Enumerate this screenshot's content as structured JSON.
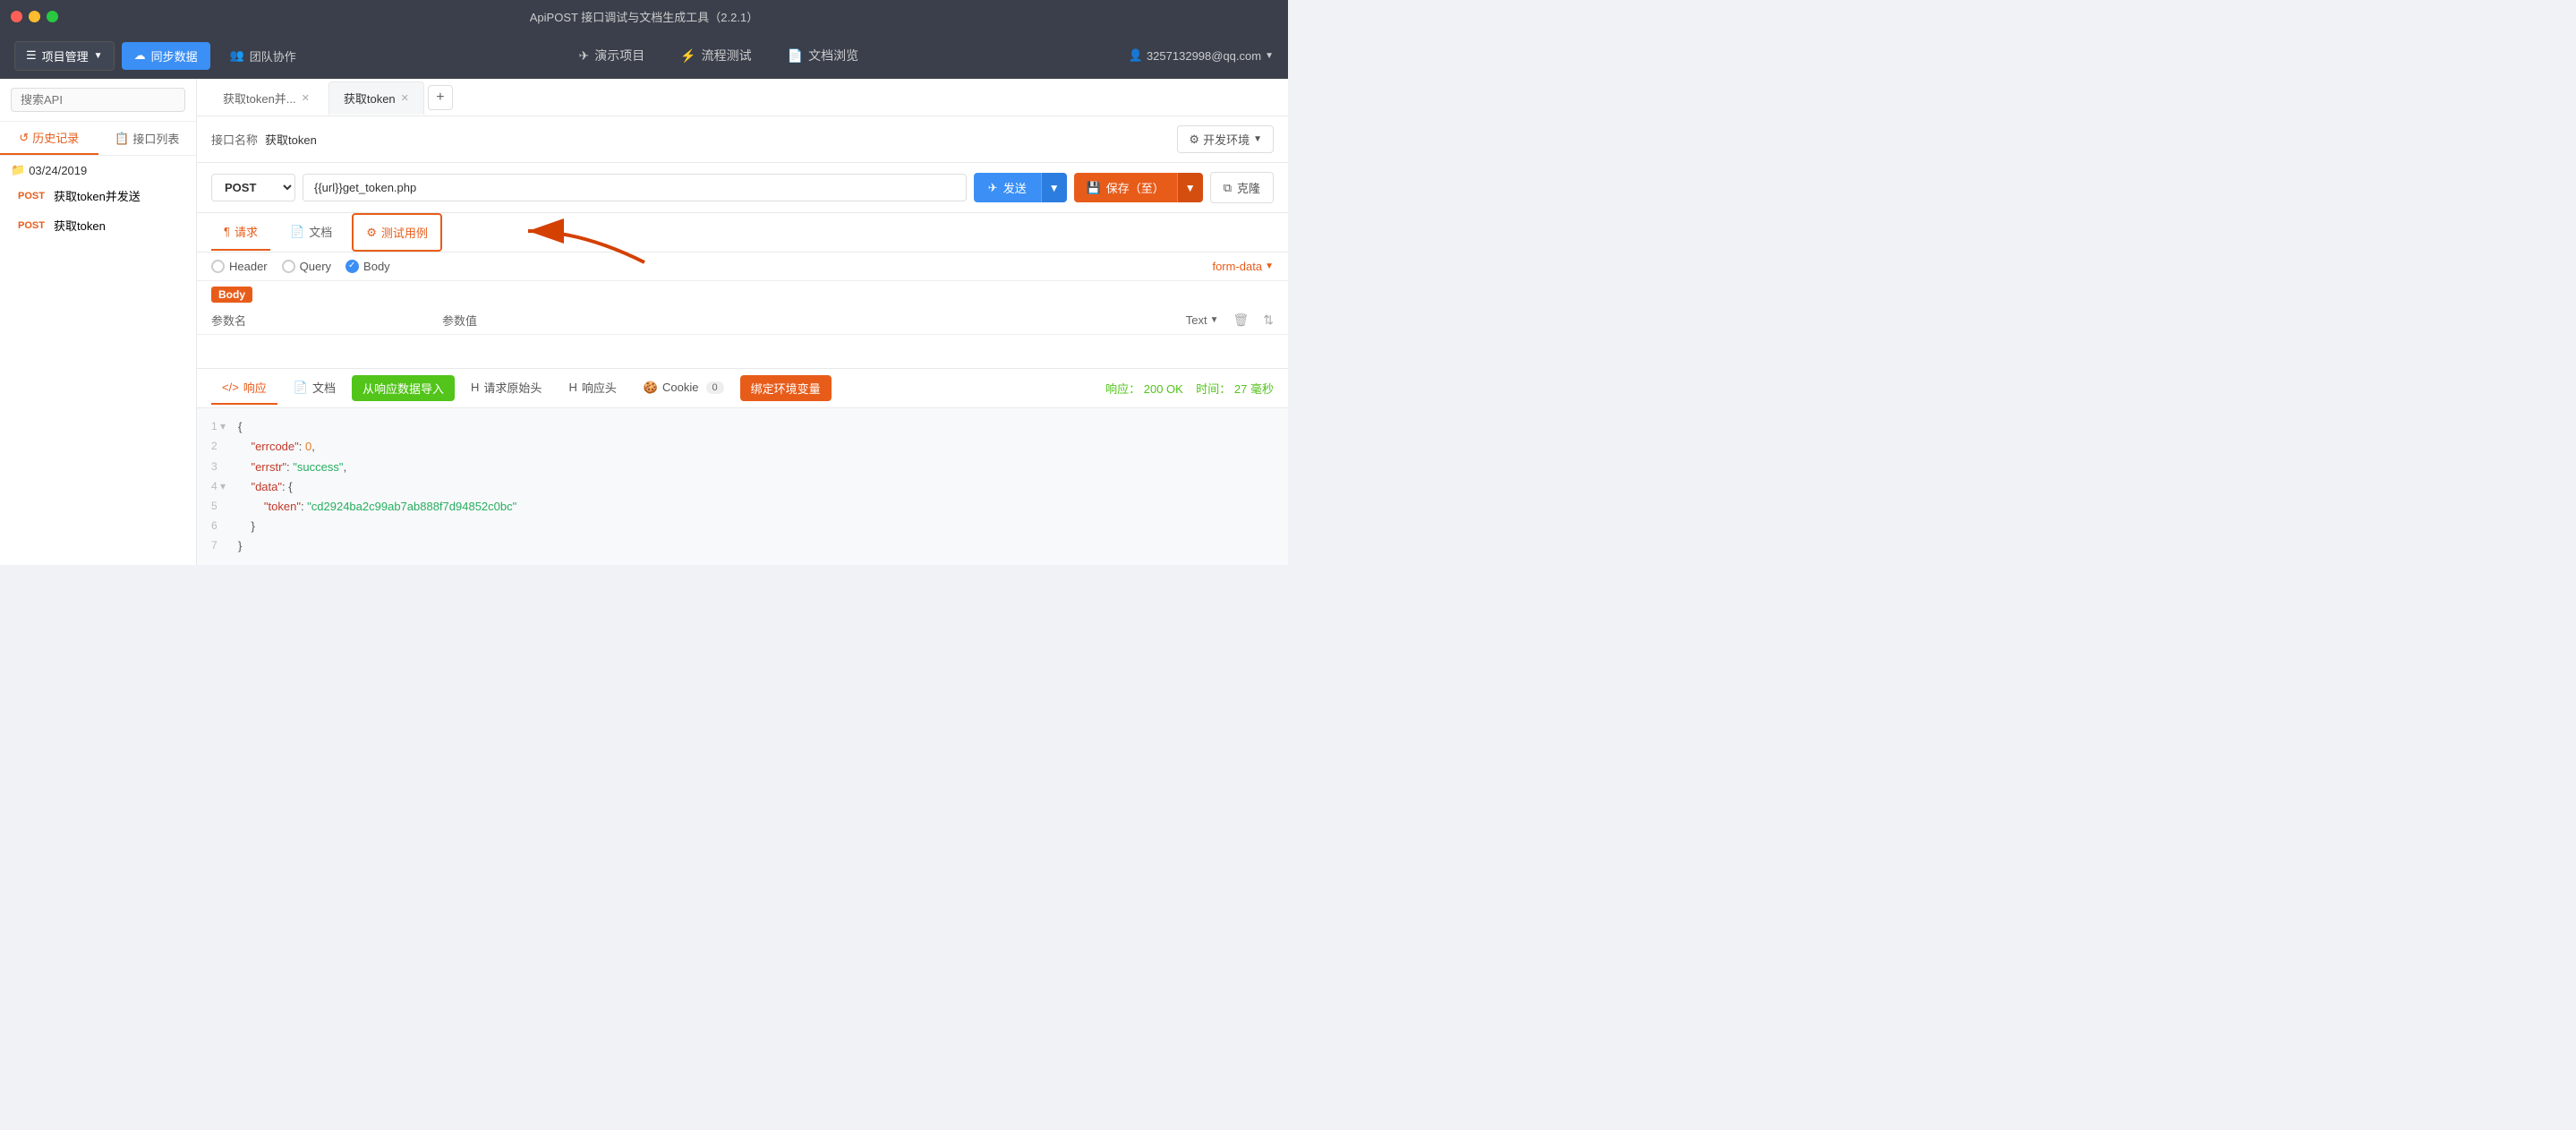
{
  "window": {
    "title": "ApiPOST 接口调试与文档生成工具（2.2.1）"
  },
  "titlebar": {
    "close": "●",
    "min": "●",
    "max": "●"
  },
  "topnav": {
    "project_mgr": "项目管理",
    "sync": "同步数据",
    "team": "团队协作",
    "demo": "演示项目",
    "flow": "流程测试",
    "docs": "文档浏览",
    "user": "3257132998@qq.com"
  },
  "sidebar": {
    "search_placeholder": "搜索API",
    "tab_history": "历史记录",
    "tab_api_list": "接口列表",
    "date_group": "03/24/2019",
    "items": [
      {
        "method": "POST",
        "name": "获取token并发送"
      },
      {
        "method": "POST",
        "name": "获取token"
      }
    ]
  },
  "tabs": {
    "items": [
      {
        "label": "获取token并..."
      },
      {
        "label": "获取token",
        "active": true
      }
    ],
    "add": "+"
  },
  "api_name": {
    "label": "接口名称",
    "value": "获取token",
    "env_btn": "开发环境"
  },
  "url_row": {
    "method": "POST",
    "url": "{{url}}get_token.php",
    "send": "发送",
    "save": "保存（至）",
    "clone": "克隆"
  },
  "request_tabs": {
    "request": "请求",
    "docs": "文档",
    "test_case": "测试用例"
  },
  "params": {
    "header_label": "Header",
    "query_label": "Query",
    "body_label": "Body",
    "form_data": "form-data",
    "col_param_name": "参数名",
    "col_param_value": "参数值",
    "col_type": "Text"
  },
  "response": {
    "resp_tab": "响应",
    "docs_tab": "文档",
    "import_btn": "从响应数据导入",
    "req_origin_head": "请求原始头",
    "resp_head": "响应头",
    "cookie": "Cookie",
    "cookie_count": "0",
    "bind_env": "绑定环境变量",
    "status_label": "响应：",
    "status_code": "200 OK",
    "time_label": "时间：",
    "time_value": "27 毫秒"
  },
  "code": {
    "lines": [
      {
        "num": "1",
        "content": "{",
        "type": "punct"
      },
      {
        "num": "2",
        "content": "    \"errcode\": 0,",
        "type": "mixed",
        "key": "errcode",
        "val": "0"
      },
      {
        "num": "3",
        "content": "    \"errstr\": \"success\",",
        "type": "mixed",
        "key": "errstr",
        "val": "\"success\""
      },
      {
        "num": "4",
        "content": "    \"data\": {",
        "type": "mixed",
        "key": "data"
      },
      {
        "num": "5",
        "content": "        \"token\": \"cd2924ba2c99ab7ab888f7d94852c0bc\"",
        "type": "mixed",
        "key": "token",
        "val": "\"cd2924ba2c99ab7ab888f7d94852c0bc\""
      },
      {
        "num": "6",
        "content": "    }",
        "type": "punct"
      },
      {
        "num": "7",
        "content": "}",
        "type": "punct"
      }
    ]
  },
  "colors": {
    "accent_orange": "#e85c1a",
    "accent_blue": "#3b8ff5",
    "accent_green": "#52c41a",
    "nav_bg": "#3a3f4b",
    "border": "#e8e8e8"
  }
}
